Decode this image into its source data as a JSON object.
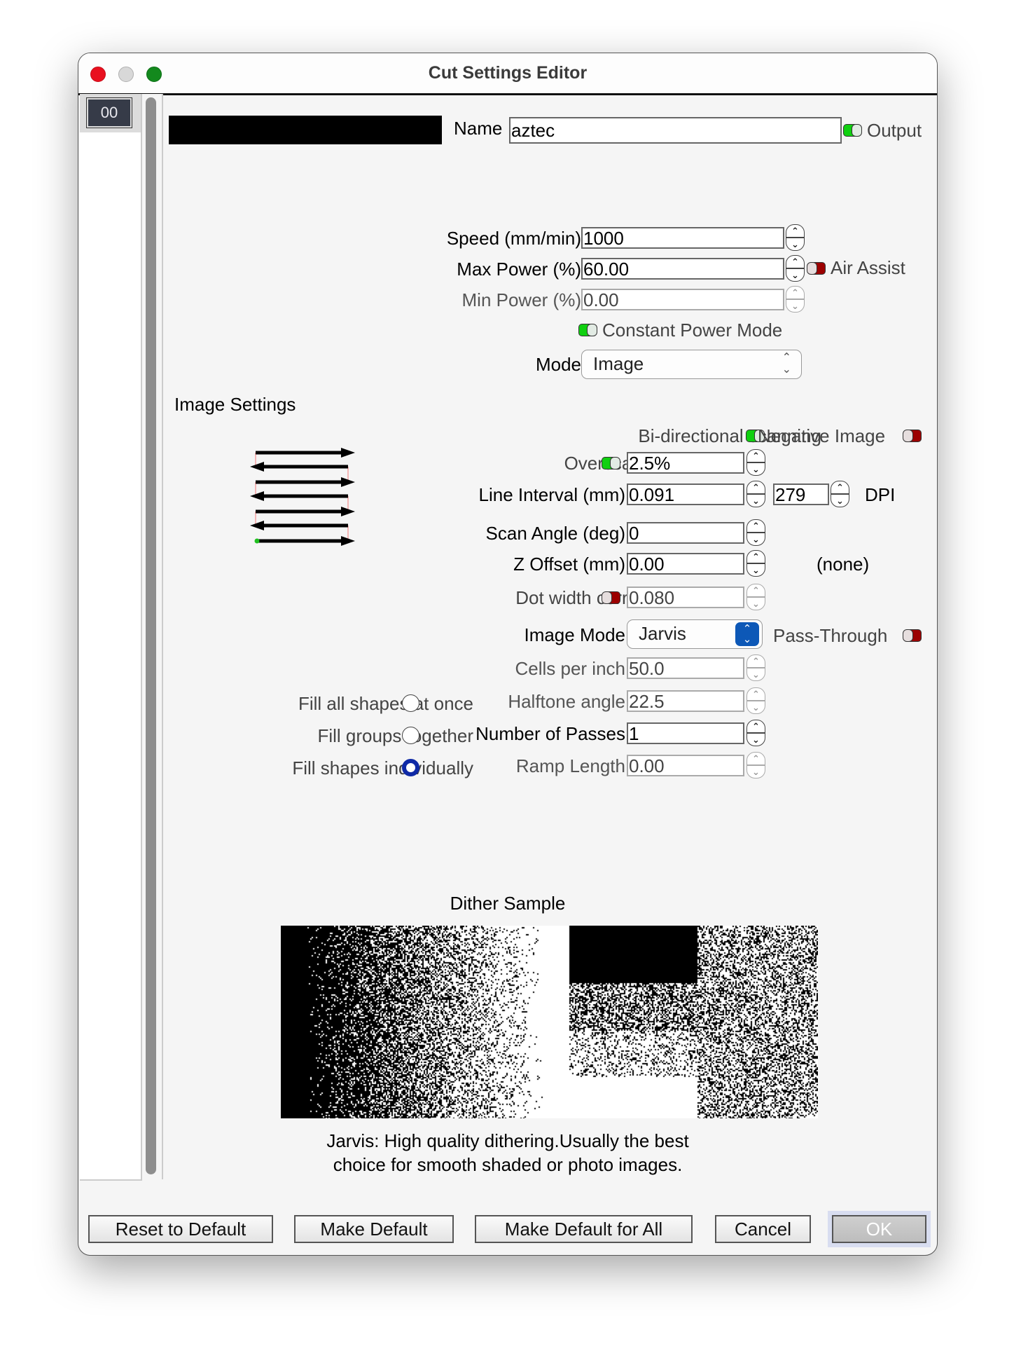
{
  "window": {
    "title": "Cut Settings Editor"
  },
  "sidebar": {
    "items": [
      {
        "label": "00"
      }
    ]
  },
  "header": {
    "name_label": "Name",
    "name_value": "aztec",
    "output_label": "Output",
    "output_on": true,
    "swatch_color": "#000000"
  },
  "power": {
    "speed_label": "Speed (mm/min)",
    "speed_value": "1000",
    "max_label": "Max Power (%)",
    "max_value": "60.00",
    "air_assist_label": "Air Assist",
    "air_assist_on": false,
    "min_label": "Min Power (%)",
    "min_value": "0.00",
    "constant_label": "Constant Power Mode",
    "constant_on": true,
    "mode_label": "Mode",
    "mode_value": "Image"
  },
  "image_settings": {
    "header": "Image Settings",
    "bidir_label": "Bi-directional scanning",
    "bidir_on": true,
    "negative_label": "Negative Image",
    "negative_on": false,
    "overscan_label": "Overscanning",
    "overscan_on": true,
    "overscan_value": "2.5%",
    "interval_label": "Line Interval (mm)",
    "interval_value": "0.091",
    "dpi_value": "279",
    "dpi_label": "DPI",
    "angle_label": "Scan Angle (deg)",
    "angle_value": "0",
    "zoffset_label": "Z Offset (mm)",
    "zoffset_value": "0.00",
    "zoffset_note": "(none)",
    "dotwidth_label": "Dot width correction",
    "dotwidth_on": false,
    "dotwidth_value": "0.080",
    "imagemode_label": "Image Mode",
    "imagemode_value": "Jarvis",
    "passthrough_label": "Pass-Through",
    "passthrough_on": false,
    "cells_label": "Cells per inch",
    "cells_value": "50.0",
    "halftone_label": "Halftone angle",
    "halftone_value": "22.5",
    "passes_label": "Number of Passes",
    "passes_value": "1",
    "ramp_label": "Ramp Length",
    "ramp_value": "0.00"
  },
  "fill": {
    "options": [
      {
        "label": "Fill all shapes at once",
        "selected": false
      },
      {
        "label": "Fill groups together",
        "selected": false
      },
      {
        "label": "Fill shapes individually",
        "selected": true
      }
    ]
  },
  "dither": {
    "title": "Dither Sample",
    "desc_line1": "Jarvis: High quality dithering.Usually the best",
    "desc_line2": "choice for smooth shaded or photo images."
  },
  "buttons": {
    "reset": "Reset to Default",
    "make_default": "Make Default",
    "make_default_all": "Make Default for All",
    "cancel": "Cancel",
    "ok": "OK"
  },
  "icons": {
    "spin_up": "⌃",
    "spin_down": "⌄",
    "updown": "⌃⌄"
  }
}
